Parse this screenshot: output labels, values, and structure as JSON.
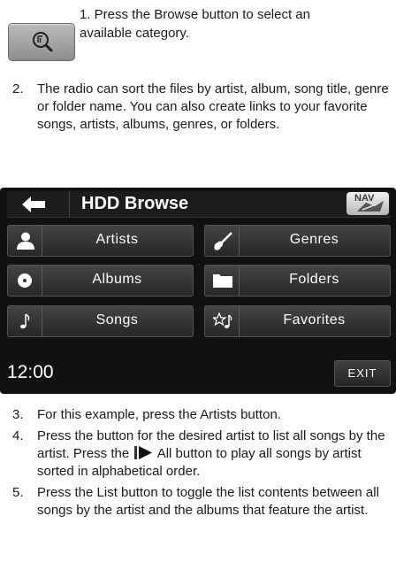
{
  "step1": {
    "text": "1. Press the Browse button to select an available category.",
    "icon": "browse-magnifier-icon"
  },
  "step2": {
    "num": "2.",
    "text": "The radio can sort the files by artist, album, song title, genre or folder name. You can also create links to your favorite songs, artists, albums, genres, or folders."
  },
  "screen": {
    "title": "HDD Browse",
    "nav_label": "NAV",
    "buttons": {
      "artists": "Artists",
      "genres": "Genres",
      "albums": "Albums",
      "folders": "Folders",
      "songs": "Songs",
      "favorites": "Favorites"
    },
    "clock": "12:00",
    "exit": "EXIT",
    "colors": {
      "background": "#111111",
      "tile": "#3a3a3a",
      "text": "#ffffff"
    }
  },
  "step3": {
    "num": "3.",
    "text": "For this example, press the Artists button."
  },
  "step4": {
    "num": "4.",
    "text_before": "Press the button for the desired artist to list all songs by the artist. Press the",
    "text_after": "All button to play all songs by artist sorted in alphabetical order."
  },
  "step5": {
    "num": "5.",
    "text": "Press the List button to toggle the list contents between all songs by the artist and the albums that feature the artist."
  }
}
